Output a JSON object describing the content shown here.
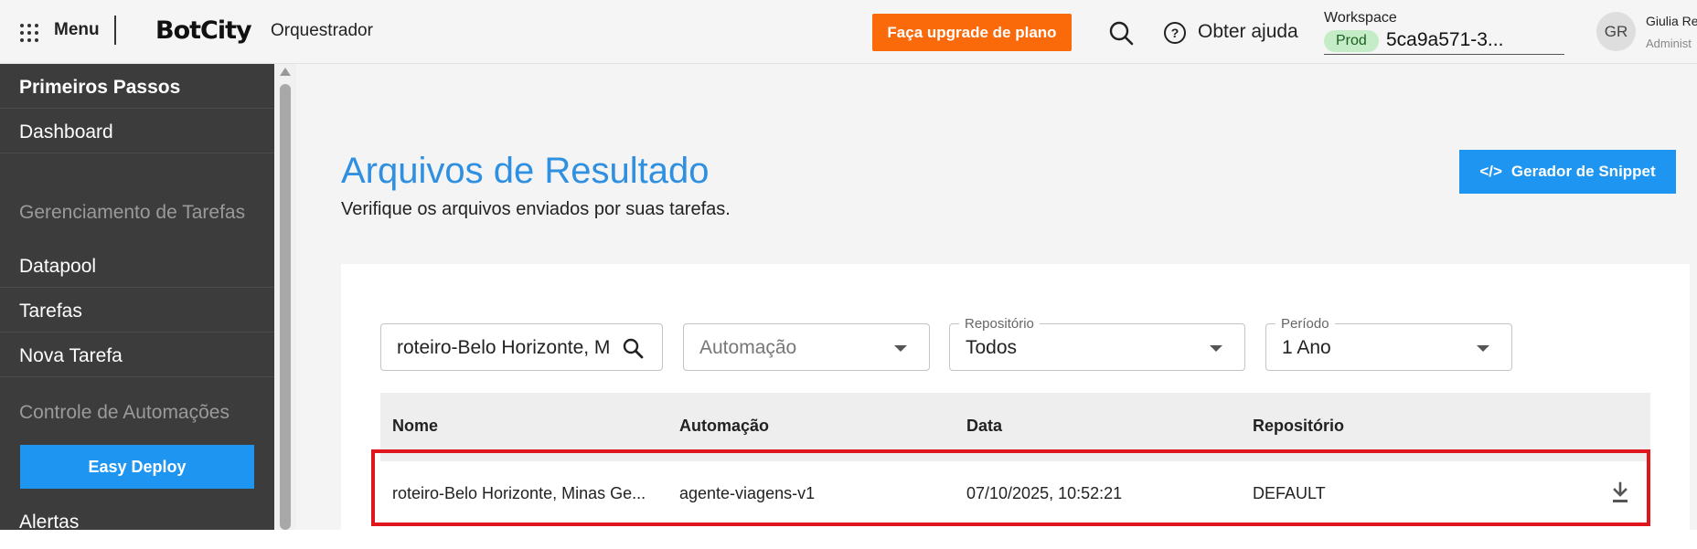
{
  "header": {
    "menu_label": "Menu",
    "logo": "BotCity",
    "app_name": "Orquestrador",
    "upgrade_label": "Faça upgrade de plano",
    "help_label": "Obter ajuda",
    "workspace_label": "Workspace",
    "env_badge": "Prod",
    "workspace_id": "5ca9a571-3...",
    "avatar_initials": "GR",
    "user_name": "Giulia Re",
    "user_role": "Administ",
    "colors": {
      "upgrade": "#fa6a0a",
      "env_badge_bg": "#c3ecc7"
    },
    "icons": [
      "apps-grid-icon",
      "search-icon",
      "help-circle-icon"
    ]
  },
  "sidebar": {
    "items": [
      {
        "label": "Primeiros Passos"
      },
      {
        "label": "Dashboard"
      },
      {
        "label": "Datapool"
      },
      {
        "label": "Tarefas"
      },
      {
        "label": "Nova Tarefa"
      },
      {
        "label": "Alertas"
      }
    ],
    "sections": {
      "tasks": "Gerenciamento de Tarefas",
      "automations": "Controle de Automações"
    },
    "deploy_label": "Easy Deploy"
  },
  "page": {
    "title": "Arquivos de Resultado",
    "subtitle": "Verifique os arquivos enviados por suas tarefas.",
    "snippet_icon": "</>",
    "snippet_label": "Gerador de Snippet"
  },
  "filters": {
    "search_value": "roteiro-Belo Horizonte, M",
    "automation_placeholder": "Automação",
    "repo_legend": "Repositório",
    "repo_value": "Todos",
    "period_legend": "Período",
    "period_value": "1 Ano"
  },
  "table": {
    "columns": [
      "Nome",
      "Automação",
      "Data",
      "Repositório"
    ],
    "rows": [
      {
        "name": "roteiro-Belo Horizonte, Minas Ge...",
        "automation": "agente-viagens-v1",
        "date": "07/10/2025, 10:52:21",
        "repo": "DEFAULT"
      }
    ]
  },
  "colors": {
    "accent": "#1e95f0",
    "title": "#2f8fe0",
    "highlight": "#e0161e",
    "sidebar": "#3c3c3c"
  }
}
